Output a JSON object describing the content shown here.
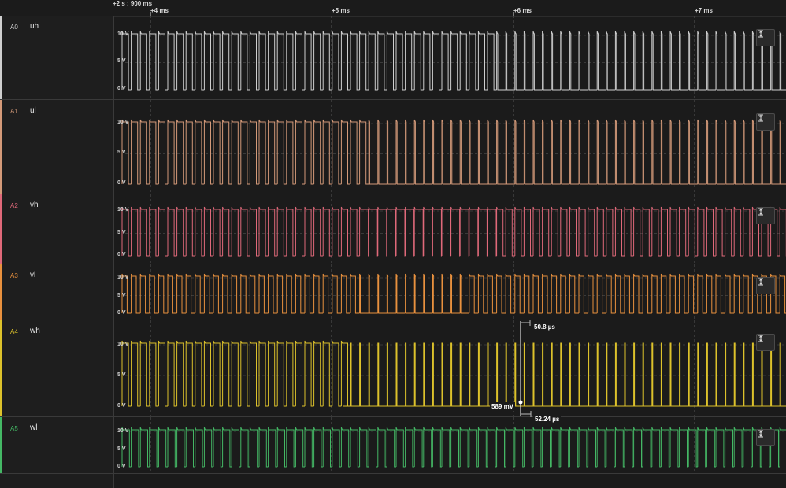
{
  "ruler": {
    "origin": "+2 s : 900 ms",
    "ticks": [
      {
        "label": "+4 ms",
        "t": 0
      },
      {
        "label": "+5 ms",
        "t": 1
      },
      {
        "label": "+6 ms",
        "t": 2
      },
      {
        "label": "+7 ms",
        "t": 3
      }
    ]
  },
  "y_labels": {
    "top": "10 V",
    "mid": "5 V",
    "bottom": "0 V"
  },
  "measurements": {
    "pulse_width": "50.8 µs",
    "period": "52.24 µs",
    "voltage": "589 mV"
  },
  "channels": [
    {
      "id": "A0",
      "name": "uh",
      "color": "#cfcfcf"
    },
    {
      "id": "A1",
      "name": "ul",
      "color": "#d49a79"
    },
    {
      "id": "A2",
      "name": "vh",
      "color": "#e0697a"
    },
    {
      "id": "A3",
      "name": "vl",
      "color": "#e9913e"
    },
    {
      "id": "A4",
      "name": "wh",
      "color": "#ddc22b"
    },
    {
      "id": "A5",
      "name": "wl",
      "color": "#44b865"
    }
  ]
}
